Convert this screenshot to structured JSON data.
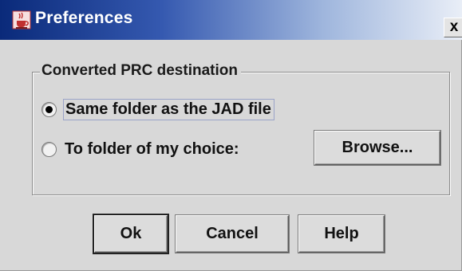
{
  "window": {
    "title": "Preferences",
    "close_label": "x"
  },
  "group": {
    "title": "Converted PRC destination",
    "options": [
      {
        "label": "Same folder as the JAD file",
        "selected": true
      },
      {
        "label": "To folder of my choice:",
        "selected": false
      }
    ],
    "browse_label": "Browse..."
  },
  "buttons": {
    "ok": "Ok",
    "cancel": "Cancel",
    "help": "Help"
  },
  "colors": {
    "titlebar_start": "#0a2a7a",
    "titlebar_end": "#e9eef7",
    "dialog_bg": "#d8d8d8"
  },
  "icons": {
    "app": "java-cup-icon",
    "close": "close-icon"
  }
}
